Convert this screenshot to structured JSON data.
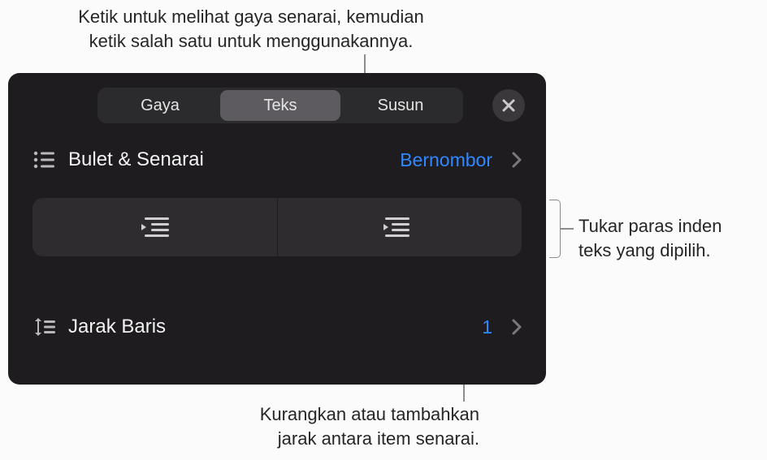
{
  "callouts": {
    "top1": "Ketik untuk melihat gaya senarai, kemudian",
    "top2": "ketik salah satu untuk menggunakannya.",
    "right1": "Tukar paras inden",
    "right2": "teks yang dipilih.",
    "bottom1": "Kurangkan atau tambahkan",
    "bottom2": "jarak antara item senarai."
  },
  "segments": {
    "style": "Gaya",
    "text": "Teks",
    "arrange": "Susun"
  },
  "bullets_row": {
    "label": "Bulet & Senarai",
    "value": "Bernombor"
  },
  "line_spacing_row": {
    "label": "Jarak Baris",
    "value": "1"
  },
  "colors": {
    "accent": "#2f88ff"
  }
}
